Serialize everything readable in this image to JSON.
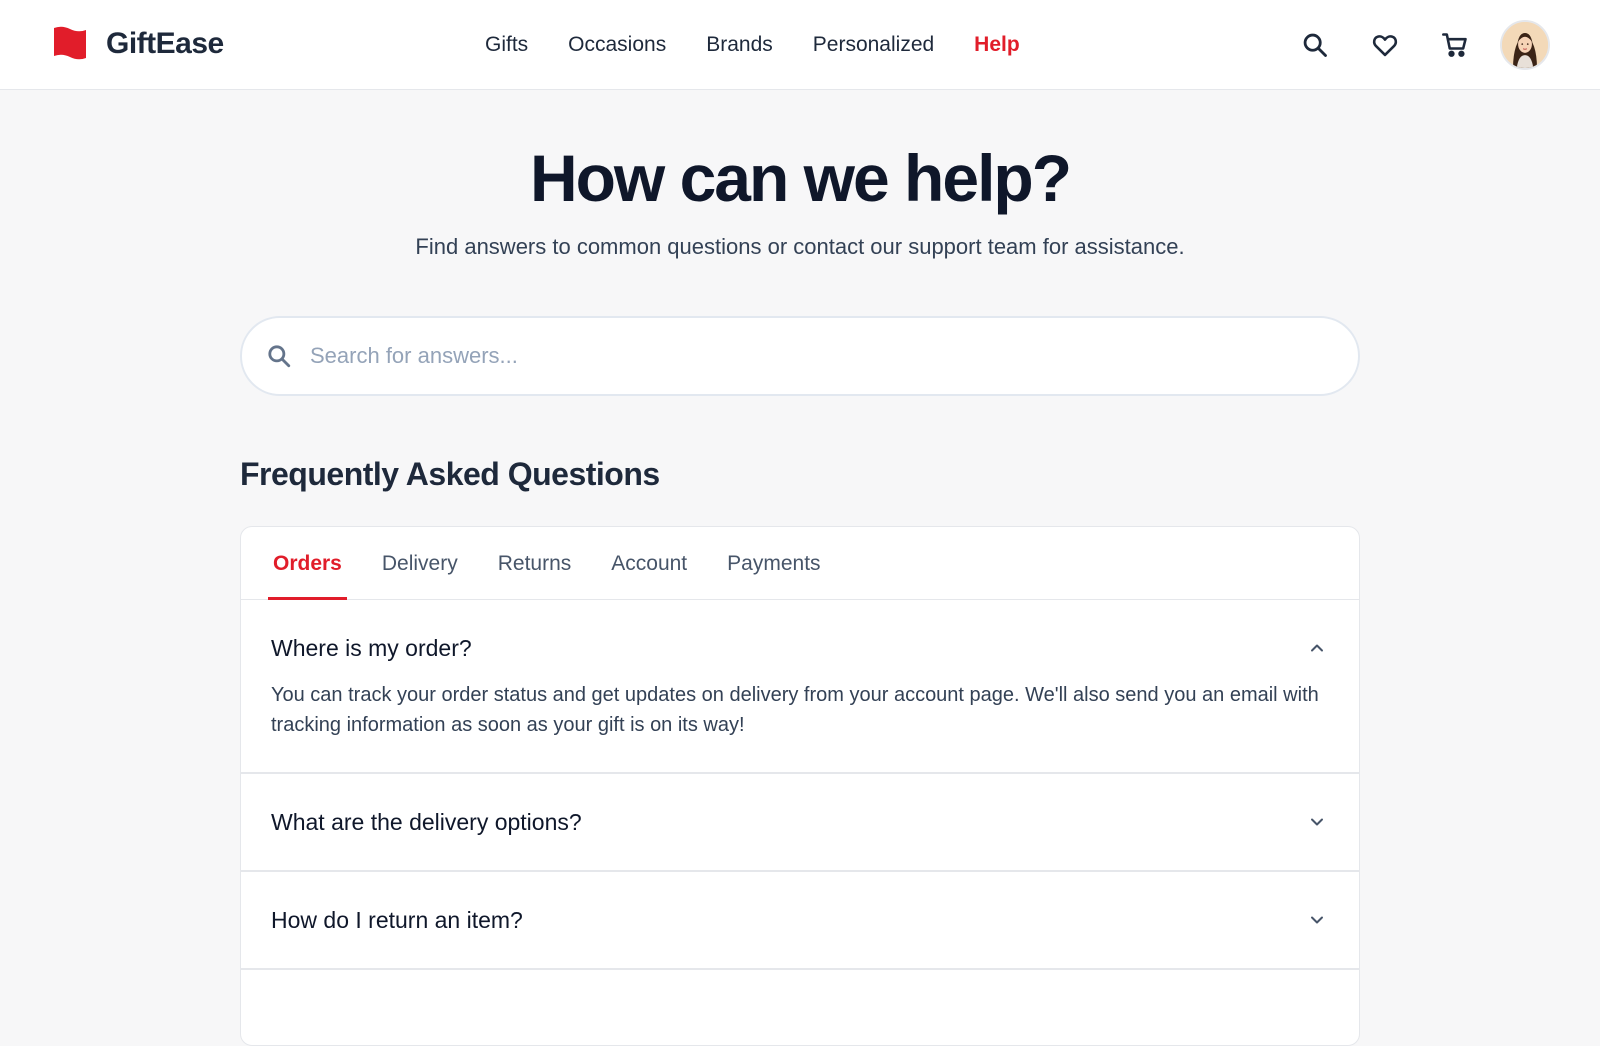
{
  "header": {
    "brand": "GiftEase",
    "nav": [
      {
        "label": "Gifts",
        "active": false
      },
      {
        "label": "Occasions",
        "active": false
      },
      {
        "label": "Brands",
        "active": false
      },
      {
        "label": "Personalized",
        "active": false
      },
      {
        "label": "Help",
        "active": true
      }
    ],
    "icons": [
      "search-icon",
      "heart-icon",
      "cart-icon"
    ],
    "accent_color": "#e11d2a"
  },
  "hero": {
    "title": "How can we help?",
    "subtitle": "Find answers to common questions or contact our support team for assistance."
  },
  "search": {
    "placeholder": "Search for answers...",
    "value": ""
  },
  "faq": {
    "title": "Frequently Asked Questions",
    "tabs": [
      {
        "label": "Orders",
        "active": true
      },
      {
        "label": "Delivery",
        "active": false
      },
      {
        "label": "Returns",
        "active": false
      },
      {
        "label": "Account",
        "active": false
      },
      {
        "label": "Payments",
        "active": false
      }
    ],
    "items": [
      {
        "question": "Where is my order?",
        "answer": "You can track your order status and get updates on delivery from your account page. We'll also send you an email with tracking information as soon as your gift is on its way!",
        "open": true
      },
      {
        "question": "What are the delivery options?",
        "answer": "",
        "open": false
      },
      {
        "question": "How do I return an item?",
        "answer": "",
        "open": false
      }
    ]
  }
}
